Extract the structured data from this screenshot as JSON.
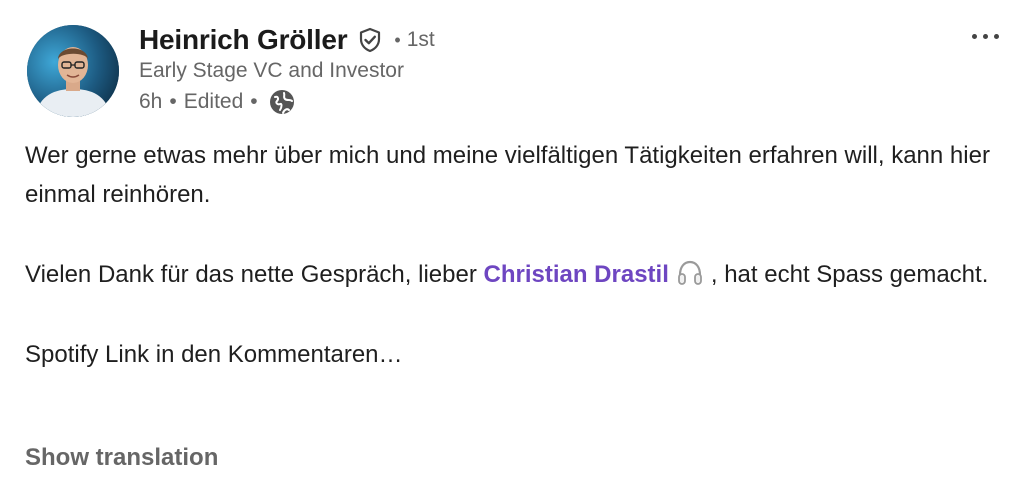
{
  "post": {
    "author": {
      "name": "Heinrich Gröller",
      "degree": "1st",
      "headline": "Early Stage VC and Investor",
      "avatar_icon": "profile-photo",
      "verified_icon": "verified-shield-icon"
    },
    "meta": {
      "time": "6h",
      "edited": "Edited",
      "visibility_icon": "globe-icon"
    },
    "more_icon": "more-horizontal-icon",
    "body": {
      "paragraph1": "Wer gerne etwas mehr über mich und meine vielfältigen Tätigkeiten erfahren will, kann hier einmal reinhören.",
      "paragraph2_before": "Vielen Dank für das nette Gespräch, lieber ",
      "mention": "Christian Drastil",
      "mention_icon": "headphones-icon",
      "paragraph2_after": ", hat echt Spass gemacht.",
      "paragraph3": "Spotify Link in den Kommentaren…"
    },
    "show_translation": "Show translation"
  },
  "colors": {
    "text": "#1f1f1f",
    "muted": "#666666",
    "mention": "#6e46c1",
    "background": "#ffffff"
  }
}
